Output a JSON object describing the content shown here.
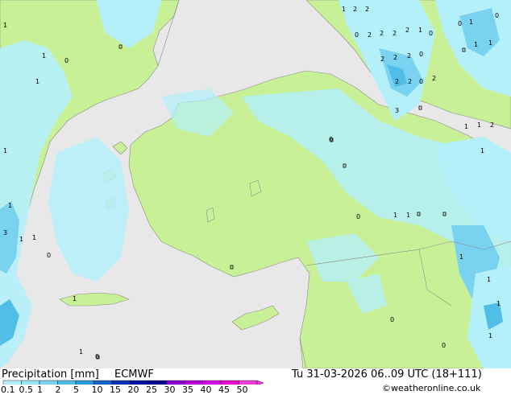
{
  "title": "Precipitation [mm]",
  "model": "ECMWF",
  "valid_time": "Tu 31-03-2026 06..09 UTC (18+111)",
  "credit": "©weatheronline.co.uk",
  "colorbar": {
    "labels": [
      "0.1",
      "0.5",
      "1",
      "2",
      "5",
      "10",
      "15",
      "20",
      "25",
      "30",
      "35",
      "40",
      "45",
      "50"
    ],
    "colors": [
      "#b4f0fa",
      "#96e6f5",
      "#78d2f0",
      "#50bee6",
      "#2896dc",
      "#1464c8",
      "#0a32b4",
      "#0014a0",
      "#00008c",
      "#8c00d2",
      "#b400dc",
      "#d200e6",
      "#e600c8",
      "#f03cdc"
    ]
  },
  "map_colors": {
    "sea": "#e8e8e8",
    "land": "#c8f096",
    "light_precip": "#b4f0fa",
    "medium_precip": "#78d2f0",
    "heavy_precip": "#50bee6"
  },
  "point_values": [
    "1",
    "2",
    "2",
    "0",
    "2",
    "2",
    "2",
    "2",
    "1",
    "0",
    "0",
    "1",
    "0",
    "2",
    "2",
    "2",
    "0",
    "2",
    "2",
    "0",
    "2",
    "1",
    "1",
    "3",
    "1",
    "1",
    "2",
    "1",
    "1",
    "1",
    "0",
    "1",
    "3",
    "1",
    "1",
    "0",
    "1",
    "1",
    "1",
    "1",
    "0",
    "0",
    "0",
    "1",
    "1",
    "1",
    "1",
    "0",
    "1",
    "0",
    "1"
  ]
}
